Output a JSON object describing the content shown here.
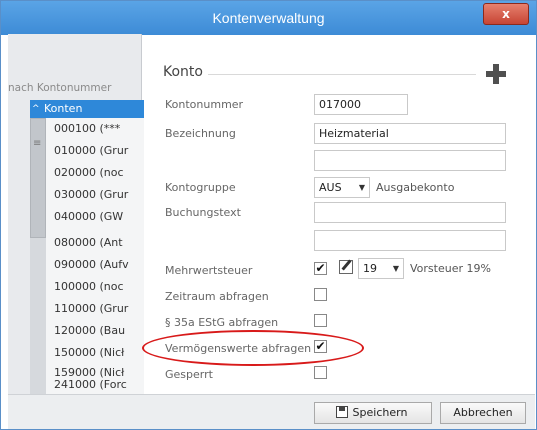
{
  "window": {
    "title": "Kontenverwaltung",
    "close_label": "x"
  },
  "left": {
    "search_placeholder": "nach Kontonummer",
    "tree_root": "Konten",
    "tree_items": [
      "000100 (***",
      "010000 (Grur",
      "020000 (noc",
      "030000 (Grur",
      "040000 (GW",
      "080000 (Ant",
      "090000 (Aufv",
      "100000 (noc",
      "110000 (Grur",
      "120000 (Bau",
      "150000 (Nicł",
      "159000 (Nicł",
      "241000 (Forc"
    ]
  },
  "konto": {
    "section_title": "Konto",
    "fields": {
      "kontonummer_label": "Kontonummer",
      "kontonummer_value": "017000",
      "bezeichnung_label": "Bezeichnung",
      "bezeichnung_value": "Heizmaterial",
      "bezeichnung2_value": "",
      "kontogruppe_label": "Kontogruppe",
      "kontogruppe_value": "AUS",
      "kontogruppe_hint": "Ausgabekonto",
      "buchungstext_label": "Buchungstext",
      "buchungstext_value": "",
      "buchungstext2_value": "",
      "mwst_label": "Mehrwertsteuer",
      "mwst_checked": true,
      "mwst_rate": "19",
      "mwst_hint": "Vorsteuer 19%",
      "zeitraum_label": "Zeitraum abfragen",
      "zeitraum_checked": false,
      "estg_label": "§ 35a EStG abfragen",
      "estg_checked": false,
      "vermoegen_label": "Vermögenswerte abfragen",
      "vermoegen_checked": true,
      "gesperrt_label": "Gesperrt",
      "gesperrt_checked": false
    }
  },
  "footer": {
    "save_label": "Speichern",
    "cancel_label": "Abbrechen"
  },
  "colors": {
    "title_bar": "#3d8bd6",
    "highlight": "#d81a1a",
    "tree_selected": "#2e88d9"
  }
}
